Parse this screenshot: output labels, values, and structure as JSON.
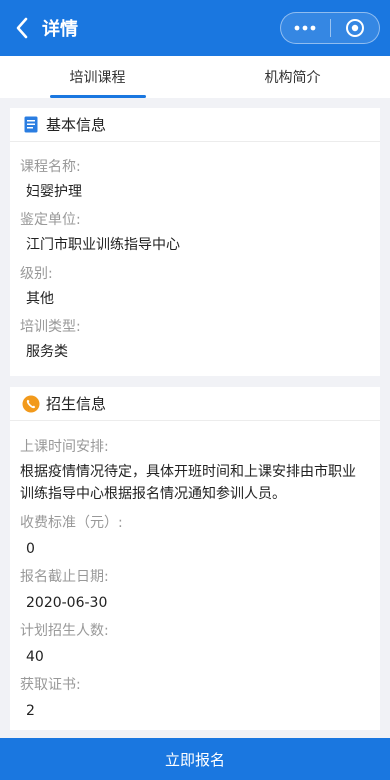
{
  "navbar": {
    "title": "详情",
    "colors": {
      "primary": "#1a77e0"
    }
  },
  "tabs": [
    {
      "label": "培训课程",
      "active": true
    },
    {
      "label": "机构简介",
      "active": false
    }
  ],
  "basic": {
    "title": "基本信息",
    "icon": "document-icon",
    "fields": [
      {
        "label": "课程名称:",
        "value": "妇婴护理"
      },
      {
        "label": "鉴定单位:",
        "value": "江门市职业训练指导中心"
      },
      {
        "label": "级别:",
        "value": "其他"
      },
      {
        "label": "培训类型:",
        "value": "服务类"
      }
    ]
  },
  "enroll": {
    "title": "招生信息",
    "icon": "phone-icon",
    "schedule_label": "上课时间安排:",
    "schedule_line1": "根据疫情情况待定，具体开班时间和上课安排由市职业",
    "schedule_line2": "训练指导中心根据报名情况通知参训人员。",
    "fee_label": "收费标准（元）:",
    "fee_value": "0",
    "deadline_label": "报名截止日期:",
    "deadline_value": "2020-06-30",
    "quota_label": "计划招生人数:",
    "quota_value": "40",
    "cert_label": "获取证书:",
    "cert_value": "2"
  },
  "footer": {
    "submit_label": "立即报名"
  }
}
